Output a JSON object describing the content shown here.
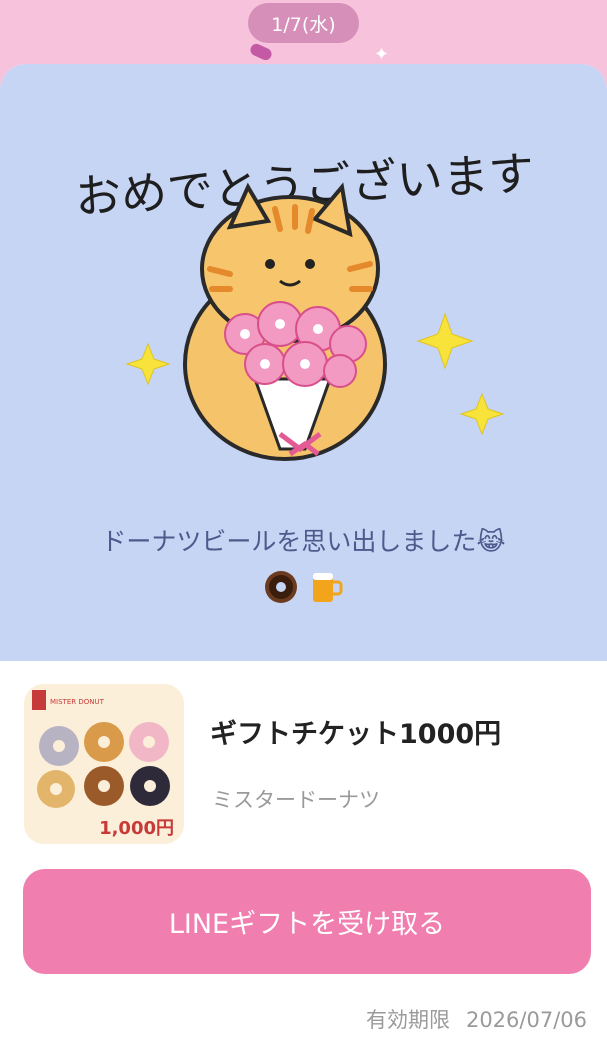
{
  "date_label": "1/7(水)",
  "greeting_text": "おめでとうございます",
  "message": {
    "line1": "ドーナツビールを思い出しました😹",
    "line2_emojis": [
      "doughnut-icon",
      "beer-mug-icon"
    ]
  },
  "product": {
    "title": "ギフトチケット1000円",
    "brand": "ミスタードーナツ",
    "thumb_logo": "MISTER DONUT",
    "thumb_price": "1,000円"
  },
  "receive_button": "LINEギフトを受け取る",
  "expiry": {
    "label": "有効期限",
    "date": "2026/07/06"
  },
  "colors": {
    "background": "#f7c3dc",
    "hero": "#c7d5f5",
    "button": "#f07fb0",
    "date_pill": "#d58fb8"
  }
}
